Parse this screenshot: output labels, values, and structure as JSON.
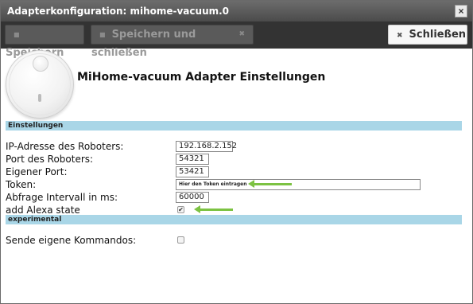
{
  "window": {
    "title": "Adapterkonfiguration: mihome-vacuum.0"
  },
  "toolbar": {
    "save_label": "Speichern",
    "save_close_label": "Speichern und schließen",
    "close_label": "Schließen"
  },
  "header": {
    "title": "MiHome-vacuum Adapter Einstellungen"
  },
  "sections": {
    "settings": "Einstellungen",
    "experimental": "experimental"
  },
  "fields": {
    "ip": {
      "label": "IP-Adresse des Roboters:",
      "value": "192.168.2.152"
    },
    "port": {
      "label": "Port des Roboters:",
      "value": "54321"
    },
    "own_port": {
      "label": "Eigener Port:",
      "value": "53421"
    },
    "token": {
      "label": "Token:",
      "value": "Hier den Token eintragen"
    },
    "interval": {
      "label": "Abfrage Intervall in ms:",
      "value": "60000"
    },
    "alexa": {
      "label": "add Alexa state",
      "checked": true,
      "check_glyph": "✔"
    },
    "commands": {
      "label": "Sende eigene Kommandos:",
      "checked": false
    }
  },
  "colors": {
    "section_bar": "#a9d6e7",
    "arrow": "#7cc242",
    "toolbar": "#333333"
  }
}
